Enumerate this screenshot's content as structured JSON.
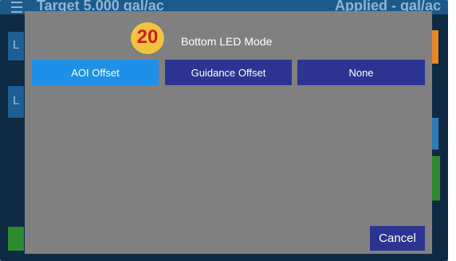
{
  "background": {
    "header_left_text": "Target 5.000 gal/ac",
    "header_right_text": "Applied - gal/ac",
    "side_letters": [
      "L",
      "L"
    ]
  },
  "dialog": {
    "badge": "20",
    "title": "Bottom LED Mode",
    "options": [
      {
        "label": "AOI Offset",
        "selected": true
      },
      {
        "label": "Guidance Offset",
        "selected": false
      },
      {
        "label": "None",
        "selected": false
      }
    ],
    "cancel_label": "Cancel"
  },
  "colors": {
    "dialog_bg": "#808080",
    "selected_button": "#1e90e8",
    "button": "#2b3491",
    "badge": "#f3c33f",
    "badge_text": "#cc1f1f"
  }
}
